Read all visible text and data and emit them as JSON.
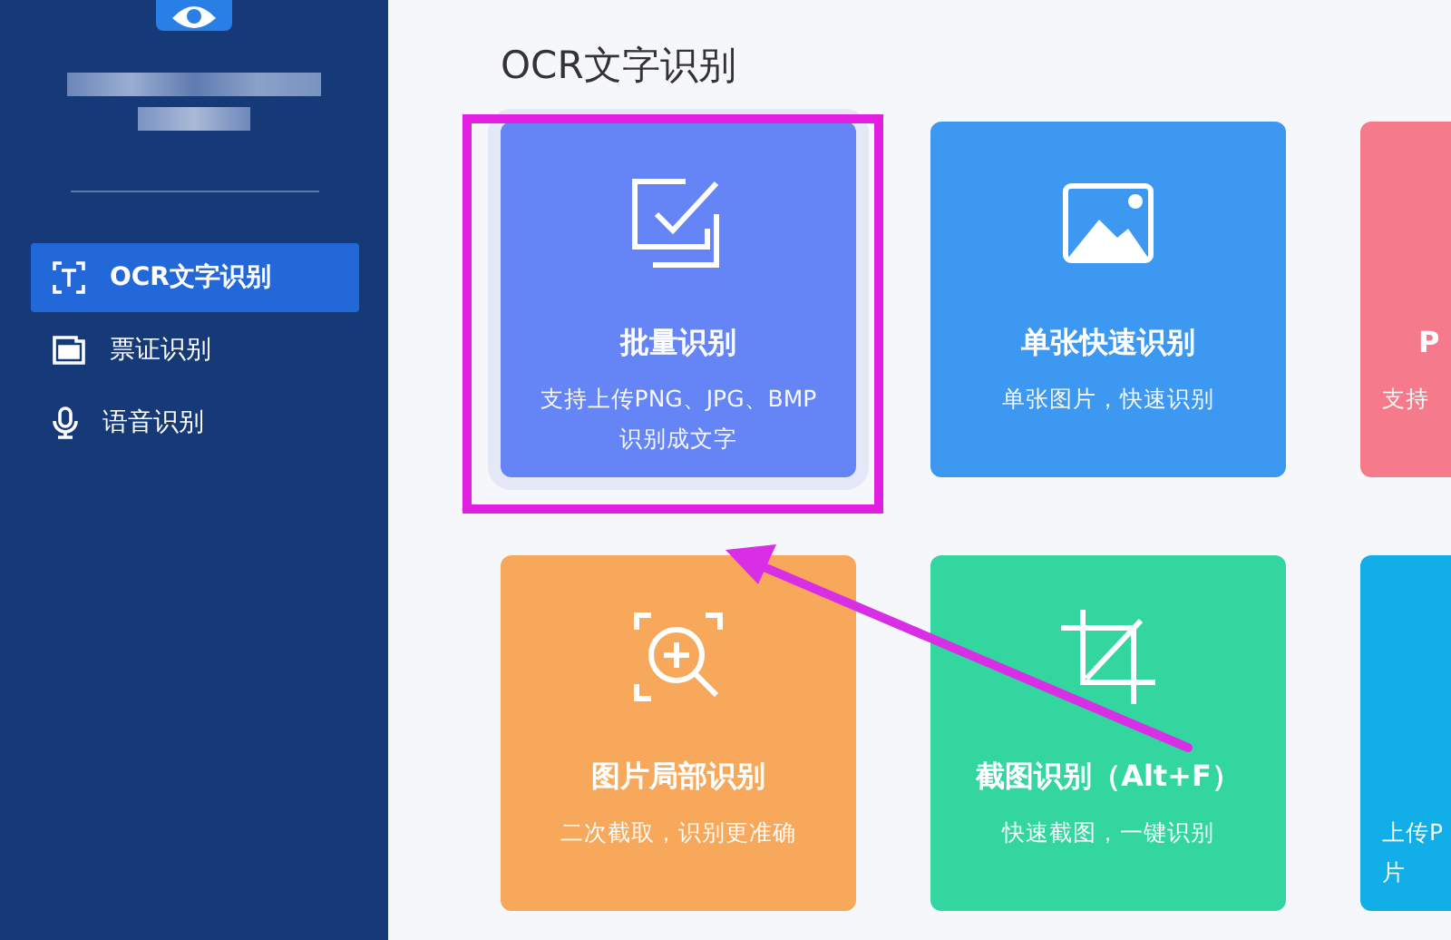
{
  "sidebar": {
    "app_name_blurred": true,
    "items": [
      {
        "label": "OCR文字识别",
        "selected": true
      },
      {
        "label": "票证识别",
        "selected": false
      },
      {
        "label": "语音识别",
        "selected": false
      }
    ]
  },
  "main": {
    "title": "OCR文字识别",
    "cards": [
      {
        "kind": "full",
        "title": "批量识别",
        "description": "支持上传PNG、JPG、BMP\n识别成文字",
        "color": "#6585f7",
        "selected": true
      },
      {
        "kind": "full",
        "title": "单张快速识别",
        "description": "单张图片，快速识别",
        "color": "#3d98f2",
        "selected": false
      },
      {
        "kind": "partial",
        "title": "P",
        "description": "支持",
        "color": "#f47a8c",
        "selected": false
      },
      {
        "kind": "full",
        "title": "图片局部识别",
        "description": "二次截取，识别更准确",
        "color": "#f7a85a",
        "selected": false
      },
      {
        "kind": "full",
        "title": "截图识别（Alt+F）",
        "description": "快速截图，一键识别",
        "color": "#33d69f",
        "selected": false
      },
      {
        "kind": "partial",
        "description": "上传P\n片",
        "color": "#12aee8",
        "selected": false
      }
    ]
  },
  "annotation": {
    "frame": true,
    "arrow": true
  }
}
